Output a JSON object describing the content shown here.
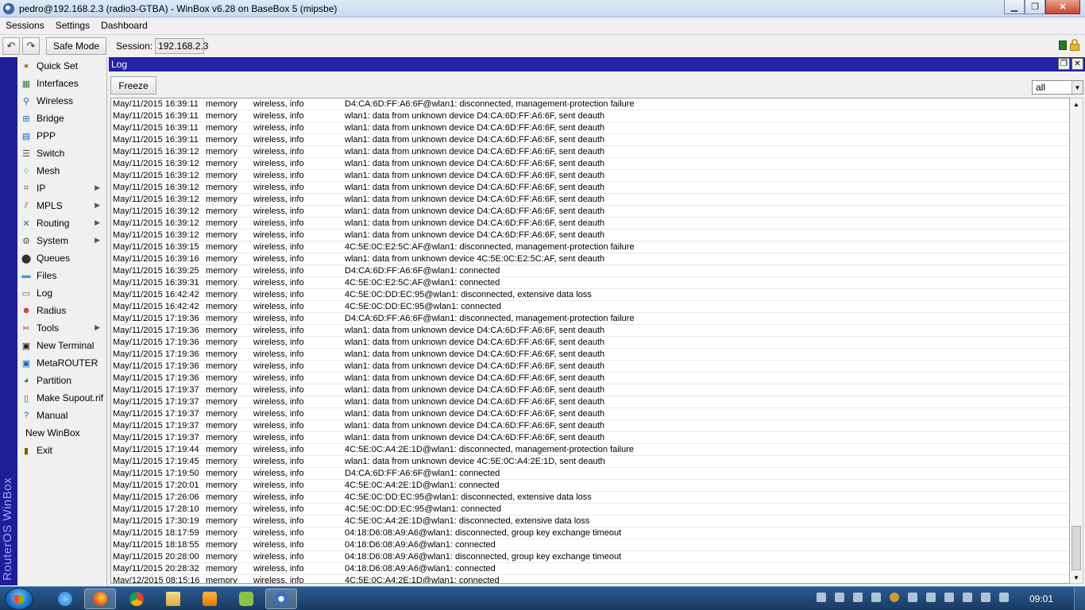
{
  "titlebar": {
    "title": "pedro@192.168.2.3 (radio3-GTBA) - WinBox v6.28 on BaseBox 5 (mipsbe)",
    "minimize_glyph": "▁",
    "maximize_glyph": "❐",
    "close_glyph": "✕"
  },
  "menubar": {
    "items": [
      "Sessions",
      "Settings",
      "Dashboard"
    ]
  },
  "toolbar": {
    "undo_icon": "undo-icon",
    "redo_icon": "redo-icon",
    "safe_mode_label": "Safe Mode",
    "session_label": "Session:",
    "session_value": "192.168.2.3",
    "status_color": "#2a7a1a"
  },
  "brand": {
    "text": "RouterOS WinBox",
    "color": "#1e1e98"
  },
  "sidebar": {
    "items": [
      {
        "label": "Quick Set",
        "icon": "wand-icon",
        "submenu": false
      },
      {
        "label": "Interfaces",
        "icon": "interfaces-icon",
        "submenu": false
      },
      {
        "label": "Wireless",
        "icon": "antenna-icon",
        "submenu": false
      },
      {
        "label": "Bridge",
        "icon": "bridge-icon",
        "submenu": false
      },
      {
        "label": "PPP",
        "icon": "ppp-icon",
        "submenu": false
      },
      {
        "label": "Switch",
        "icon": "switch-icon",
        "submenu": false
      },
      {
        "label": "Mesh",
        "icon": "mesh-icon",
        "submenu": false
      },
      {
        "label": "IP",
        "icon": "ip-icon",
        "submenu": true
      },
      {
        "label": "MPLS",
        "icon": "mpls-icon",
        "submenu": true
      },
      {
        "label": "Routing",
        "icon": "routing-icon",
        "submenu": true
      },
      {
        "label": "System",
        "icon": "gear-icon",
        "submenu": true
      },
      {
        "label": "Queues",
        "icon": "queues-icon",
        "submenu": false
      },
      {
        "label": "Files",
        "icon": "folder-icon",
        "submenu": false
      },
      {
        "label": "Log",
        "icon": "log-icon",
        "submenu": false
      },
      {
        "label": "Radius",
        "icon": "users-icon",
        "submenu": false
      },
      {
        "label": "Tools",
        "icon": "tools-icon",
        "submenu": true
      },
      {
        "label": "New Terminal",
        "icon": "terminal-icon",
        "submenu": false
      },
      {
        "label": "MetaROUTER",
        "icon": "metarouter-icon",
        "submenu": false
      },
      {
        "label": "Partition",
        "icon": "pie-icon",
        "submenu": false
      },
      {
        "label": "Make Supout.rif",
        "icon": "document-icon",
        "submenu": false
      },
      {
        "label": "Manual",
        "icon": "help-icon",
        "submenu": false
      },
      {
        "label": "New WinBox",
        "icon": "",
        "submenu": false
      },
      {
        "label": "Exit",
        "icon": "exit-icon",
        "submenu": false
      }
    ]
  },
  "log": {
    "title": "Log",
    "freeze_label": "Freeze",
    "filter_value": "all",
    "rows": [
      [
        "May/11/2015 16:39:11",
        "memory",
        "wireless, info",
        "D4:CA:6D:FF:A6:6F@wlan1: disconnected, management-protection failure"
      ],
      [
        "May/11/2015 16:39:11",
        "memory",
        "wireless, info",
        "wlan1: data from unknown device D4:CA:6D:FF:A6:6F, sent deauth"
      ],
      [
        "May/11/2015 16:39:11",
        "memory",
        "wireless, info",
        "wlan1: data from unknown device D4:CA:6D:FF:A6:6F, sent deauth"
      ],
      [
        "May/11/2015 16:39:11",
        "memory",
        "wireless, info",
        "wlan1: data from unknown device D4:CA:6D:FF:A6:6F, sent deauth"
      ],
      [
        "May/11/2015 16:39:12",
        "memory",
        "wireless, info",
        "wlan1: data from unknown device D4:CA:6D:FF:A6:6F, sent deauth"
      ],
      [
        "May/11/2015 16:39:12",
        "memory",
        "wireless, info",
        "wlan1: data from unknown device D4:CA:6D:FF:A6:6F, sent deauth"
      ],
      [
        "May/11/2015 16:39:12",
        "memory",
        "wireless, info",
        "wlan1: data from unknown device D4:CA:6D:FF:A6:6F, sent deauth"
      ],
      [
        "May/11/2015 16:39:12",
        "memory",
        "wireless, info",
        "wlan1: data from unknown device D4:CA:6D:FF:A6:6F, sent deauth"
      ],
      [
        "May/11/2015 16:39:12",
        "memory",
        "wireless, info",
        "wlan1: data from unknown device D4:CA:6D:FF:A6:6F, sent deauth"
      ],
      [
        "May/11/2015 16:39:12",
        "memory",
        "wireless, info",
        "wlan1: data from unknown device D4:CA:6D:FF:A6:6F, sent deauth"
      ],
      [
        "May/11/2015 16:39:12",
        "memory",
        "wireless, info",
        "wlan1: data from unknown device D4:CA:6D:FF:A6:6F, sent deauth"
      ],
      [
        "May/11/2015 16:39:12",
        "memory",
        "wireless, info",
        "wlan1: data from unknown device D4:CA:6D:FF:A6:6F, sent deauth"
      ],
      [
        "May/11/2015 16:39:15",
        "memory",
        "wireless, info",
        "4C:5E:0C:E2:5C:AF@wlan1: disconnected, management-protection failure"
      ],
      [
        "May/11/2015 16:39:16",
        "memory",
        "wireless, info",
        "wlan1: data from unknown device 4C:5E:0C:E2:5C:AF, sent deauth"
      ],
      [
        "May/11/2015 16:39:25",
        "memory",
        "wireless, info",
        "D4:CA:6D:FF:A6:6F@wlan1: connected"
      ],
      [
        "May/11/2015 16:39:31",
        "memory",
        "wireless, info",
        "4C:5E:0C:E2:5C:AF@wlan1: connected"
      ],
      [
        "May/11/2015 16:42:42",
        "memory",
        "wireless, info",
        "4C:5E:0C:DD:EC:95@wlan1: disconnected, extensive data loss"
      ],
      [
        "May/11/2015 16:42:42",
        "memory",
        "wireless, info",
        "4C:5E:0C:DD:EC:95@wlan1: connected"
      ],
      [
        "May/11/2015 17:19:36",
        "memory",
        "wireless, info",
        "D4:CA:6D:FF:A6:6F@wlan1: disconnected, management-protection failure"
      ],
      [
        "May/11/2015 17:19:36",
        "memory",
        "wireless, info",
        "wlan1: data from unknown device D4:CA:6D:FF:A6:6F, sent deauth"
      ],
      [
        "May/11/2015 17:19:36",
        "memory",
        "wireless, info",
        "wlan1: data from unknown device D4:CA:6D:FF:A6:6F, sent deauth"
      ],
      [
        "May/11/2015 17:19:36",
        "memory",
        "wireless, info",
        "wlan1: data from unknown device D4:CA:6D:FF:A6:6F, sent deauth"
      ],
      [
        "May/11/2015 17:19:36",
        "memory",
        "wireless, info",
        "wlan1: data from unknown device D4:CA:6D:FF:A6:6F, sent deauth"
      ],
      [
        "May/11/2015 17:19:36",
        "memory",
        "wireless, info",
        "wlan1: data from unknown device D4:CA:6D:FF:A6:6F, sent deauth"
      ],
      [
        "May/11/2015 17:19:37",
        "memory",
        "wireless, info",
        "wlan1: data from unknown device D4:CA:6D:FF:A6:6F, sent deauth"
      ],
      [
        "May/11/2015 17:19:37",
        "memory",
        "wireless, info",
        "wlan1: data from unknown device D4:CA:6D:FF:A6:6F, sent deauth"
      ],
      [
        "May/11/2015 17:19:37",
        "memory",
        "wireless, info",
        "wlan1: data from unknown device D4:CA:6D:FF:A6:6F, sent deauth"
      ],
      [
        "May/11/2015 17:19:37",
        "memory",
        "wireless, info",
        "wlan1: data from unknown device D4:CA:6D:FF:A6:6F, sent deauth"
      ],
      [
        "May/11/2015 17:19:37",
        "memory",
        "wireless, info",
        "wlan1: data from unknown device D4:CA:6D:FF:A6:6F, sent deauth"
      ],
      [
        "May/11/2015 17:19:44",
        "memory",
        "wireless, info",
        "4C:5E:0C:A4:2E:1D@wlan1: disconnected, management-protection failure"
      ],
      [
        "May/11/2015 17:19:45",
        "memory",
        "wireless, info",
        "wlan1: data from unknown device 4C:5E:0C:A4:2E:1D, sent deauth"
      ],
      [
        "May/11/2015 17:19:50",
        "memory",
        "wireless, info",
        "D4:CA:6D:FF:A6:6F@wlan1: connected"
      ],
      [
        "May/11/2015 17:20:01",
        "memory",
        "wireless, info",
        "4C:5E:0C:A4:2E:1D@wlan1: connected"
      ],
      [
        "May/11/2015 17:26:06",
        "memory",
        "wireless, info",
        "4C:5E:0C:DD:EC:95@wlan1: disconnected, extensive data loss"
      ],
      [
        "May/11/2015 17:28:10",
        "memory",
        "wireless, info",
        "4C:5E:0C:DD:EC:95@wlan1: connected"
      ],
      [
        "May/11/2015 17:30:19",
        "memory",
        "wireless, info",
        "4C:5E:0C:A4:2E:1D@wlan1: disconnected, extensive data loss"
      ],
      [
        "May/11/2015 18:17:59",
        "memory",
        "wireless, info",
        "04:18:D6:08:A9:A6@wlan1: disconnected, group key exchange timeout"
      ],
      [
        "May/11/2015 18:18:55",
        "memory",
        "wireless, info",
        "04:18:D6:08:A9:A6@wlan1: connected"
      ],
      [
        "May/11/2015 20:28:00",
        "memory",
        "wireless, info",
        "04:18:D6:08:A9:A6@wlan1: disconnected, group key exchange timeout"
      ],
      [
        "May/11/2015 20:28:32",
        "memory",
        "wireless, info",
        "04:18:D6:08:A9:A6@wlan1: connected"
      ],
      [
        "May/12/2015 08:15:16",
        "memory",
        "wireless, info",
        "4C:5E:0C:A4:2E:1D@wlan1: connected"
      ]
    ]
  },
  "taskbar": {
    "apps": [
      "internet-explorer-icon",
      "firefox-icon",
      "chrome-icon",
      "file-explorer-icon",
      "media-player-icon",
      "android-icon",
      "winbox-icon"
    ],
    "clock": "09:01"
  }
}
